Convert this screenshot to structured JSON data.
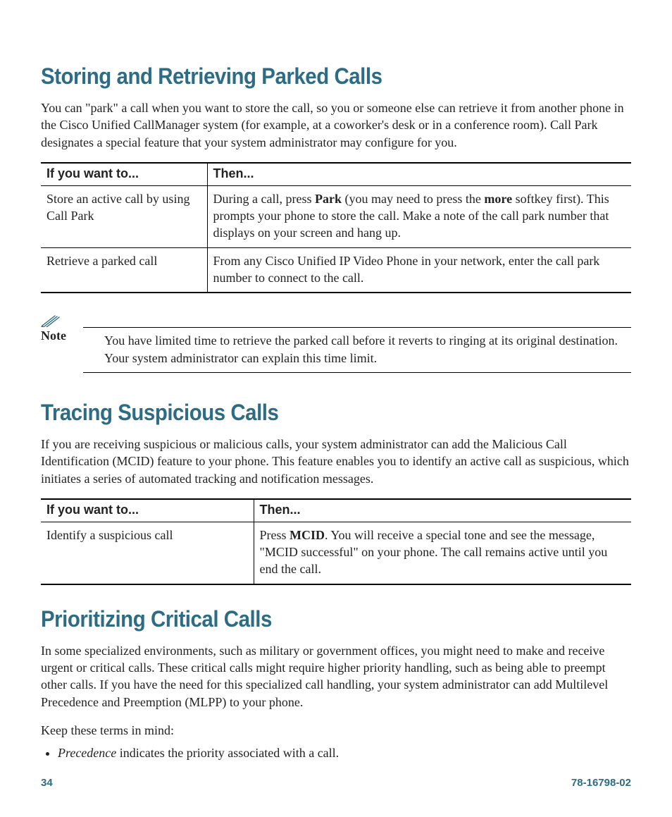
{
  "section1": {
    "heading": "Storing and Retrieving Parked Calls",
    "intro": "You can \"park\" a call when you want to store the call, so you or someone else can retrieve it from another phone in the Cisco Unified CallManager system (for example, at a coworker's desk or in a conference room). Call Park designates a special feature that your system administrator may configure for you.",
    "table": {
      "headers": {
        "col1": "If you want to...",
        "col2": "Then..."
      },
      "rows": [
        {
          "c1": "Store an active call by using Call Park",
          "c2_pre": "During a call, press ",
          "c2_b1": "Park",
          "c2_mid": " (you may need to press the ",
          "c2_b2": "more",
          "c2_post": " softkey first). This prompts your phone to store the call. Make a note of the call park number that displays on your screen and hang up."
        },
        {
          "c1": "Retrieve a parked call",
          "c2": "From any Cisco Unified IP Video Phone in your network, enter the call park number to connect to the call."
        }
      ]
    },
    "note_label": "Note",
    "note_text": "You have limited time to retrieve the parked call before it reverts to ringing at its original destination. Your system administrator can explain this time limit."
  },
  "section2": {
    "heading": "Tracing Suspicious Calls",
    "intro": "If you are receiving suspicious or malicious calls, your system administrator can add the Malicious Call Identification (MCID) feature to your phone. This feature enables you to identify an active call as suspicious, which initiates a series of automated tracking and notification messages.",
    "table": {
      "headers": {
        "col1": "If you want to...",
        "col2": "Then..."
      },
      "rows": [
        {
          "c1": "Identify a suspicious call",
          "c2_pre": "Press ",
          "c2_b1": "MCID",
          "c2_post": ". You will receive a special tone and see the message, \"MCID successful\" on your phone. The call remains active until you end the call."
        }
      ]
    }
  },
  "section3": {
    "heading": "Prioritizing Critical Calls",
    "intro": "In some specialized environments, such as military or government offices, you might need to make and receive urgent or critical calls. These critical calls might require higher priority handling, such as being able to preempt other calls. If you have the need for this specialized call handling, your system administrator can add Multilevel Precedence and Preemption (MLPP) to your phone.",
    "keep": "Keep these terms in mind:",
    "term1_em": "Precedence",
    "term1_rest": " indicates the priority associated with a call."
  },
  "footer": {
    "page": "34",
    "docid": "78-16798-02"
  }
}
